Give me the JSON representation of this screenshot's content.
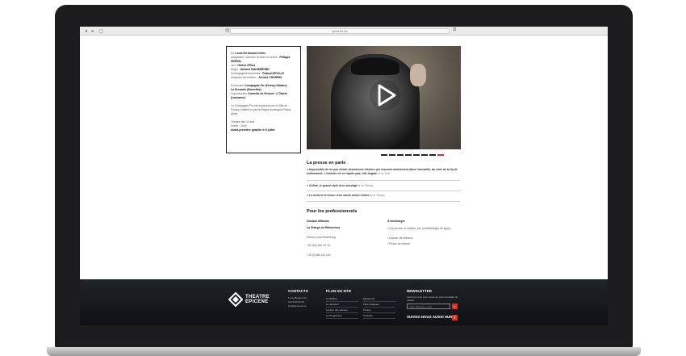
{
  "browser": {
    "nav_glyphs": "◂ ▸  ▢",
    "url": "epicene.be",
    "reader_icon": "▤",
    "share_icon": "⧉"
  },
  "credits": {
    "line1_prefix": "De",
    "line1_name": "Louis-Ferdinand Céline",
    "line2_prefix": "Adaptation, scénario et mise en scène :",
    "line2_name": "Philippe SIREUIL",
    "line3_prefix": "Jeu :",
    "line3_name": "Hélène FIRLA",
    "line4_prefix": "Régie :",
    "line4_name": "Antoine BALIBERHNE",
    "line5_prefix": "Scénographie/costumes :",
    "line5_name": "Roland DEVILLE",
    "line6_prefix": "Assistant de création :",
    "line6_name": "Zenobe CHARRIN",
    "prod_prefix": "Production",
    "prod_name": "Compagnie Fer (Ferney-Voltaire)",
    "prod2": "La Servante (Bruxelles)",
    "coprod_prefix": "Coproduction",
    "coprod_name": "Comédie de Genève",
    "coprod_name2": "L'Ostest (Lausanne)",
    "support": "La Compagnie Fer est soutenue par la Ville de Ferney-Voltaire et par la Région Auvergne-Rhône-Alpes",
    "duration": "Théâtre dès 14 ans",
    "duration2": "Durée : 1h15",
    "premiere": "Avant-première gratuite le 6 juillet"
  },
  "slider": {
    "count": 8,
    "active_index": 7
  },
  "press": {
    "title": "La presse en parle",
    "q1": "« Impossible de ne pas frémir devant une histoire qui résonne amèrement dans l'actualité, du côté de la Syrie notamment. L'histoire ne se répète pas, elle bégaie. »",
    "q1_src": "Le Soir",
    "q2": "« Céline, le grand style d'un sauvage »",
    "q2_src": "Le Temps",
    "q3": "« Le bruit et la fureur d'un siècle selon Céline »",
    "q3_src": "Le Temps"
  },
  "pros": {
    "title": "Pour les professionnels",
    "contact_title": "Contact diffusion",
    "contact_name": "La Charge du Rhinocéros",
    "contact_person": "Pierre-Louis Rosenberg",
    "phone1": "+32 (0)2 644 42 43",
    "phone2": "+32 (0)488 141 160",
    "dl_title": "À télécharger",
    "dl1": "Les photos, le dossier, etc. (à télécharger en ligne)",
    "dl2": "Dossier de diffusion",
    "dl3": "Revue de presse"
  },
  "footer": {
    "logo_line1": "THEATRE",
    "logo_line2": "EPICENE",
    "contacts_title": "CONTACTS",
    "contacts_lines": [
      "1 rue Maurice Ch.",
      "04 00 00 00 00",
      "info@epicene.be"
    ],
    "plan_title": "PLAN DU SITE",
    "plan_col1": [
      "Le théâtre",
      "Le directeur",
      "Lecture des saisons",
      "Le Programme"
    ],
    "plan_col2": [
      "Equipe/Tis",
      "Infos pratiques",
      "Presse",
      "Contacts"
    ],
    "newsletter_title": "NEWSLETTER",
    "newsletter_text": "Abonnez-vous pour suivre de près l'actualité du théâtre",
    "newsletter_placeholder": "Votre adresse e-mail",
    "newsletter_btn": "»",
    "follow_title": "SUIVEZ-NOUS AUSSI SUR",
    "fb_glyph": "f"
  },
  "colors": {
    "accent": "#c0392b",
    "footer_bg": "#15181c"
  }
}
